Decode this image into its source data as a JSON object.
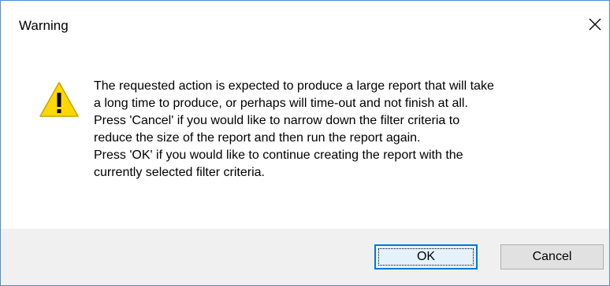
{
  "dialog": {
    "title": "Warning",
    "close_label": "✕",
    "icon": "warning-triangle-icon",
    "message_lines": [
      "The requested action is expected to produce a large report that will take",
      "a long time to produce, or perhaps will time-out and not finish at all.",
      "Press 'Cancel' if you would like to narrow down the filter criteria to",
      "reduce the size of the report and then run the report again.",
      "Press 'OK' if you would like to continue creating the report with the",
      "currently selected filter criteria."
    ],
    "buttons": {
      "ok_label": "OK",
      "cancel_label": "Cancel"
    }
  },
  "colors": {
    "border": "#4a8fd8",
    "footer_bg": "#f0f0f0",
    "warning_fill": "#ffd800",
    "default_button_border": "#0078d7"
  }
}
